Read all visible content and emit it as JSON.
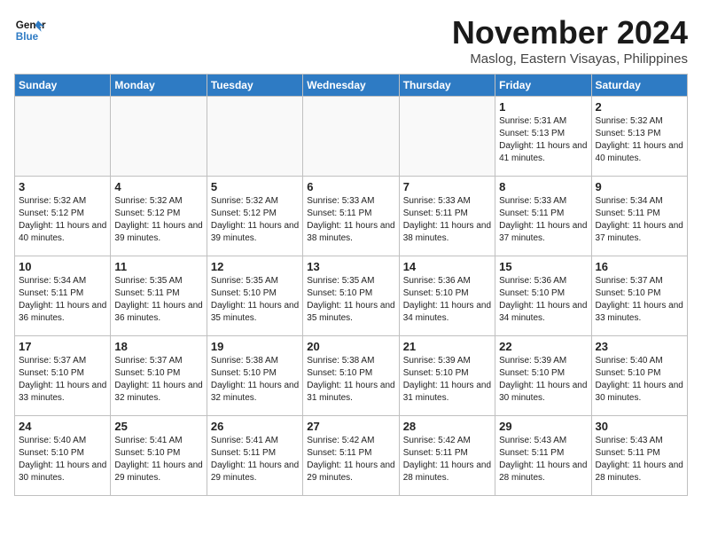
{
  "header": {
    "logo_line1": "General",
    "logo_line2": "Blue",
    "month": "November 2024",
    "location": "Maslog, Eastern Visayas, Philippines"
  },
  "weekdays": [
    "Sunday",
    "Monday",
    "Tuesday",
    "Wednesday",
    "Thursday",
    "Friday",
    "Saturday"
  ],
  "weeks": [
    [
      {
        "day": "",
        "sunrise": "",
        "sunset": "",
        "daylight": "",
        "empty": true
      },
      {
        "day": "",
        "sunrise": "",
        "sunset": "",
        "daylight": "",
        "empty": true
      },
      {
        "day": "",
        "sunrise": "",
        "sunset": "",
        "daylight": "",
        "empty": true
      },
      {
        "day": "",
        "sunrise": "",
        "sunset": "",
        "daylight": "",
        "empty": true
      },
      {
        "day": "",
        "sunrise": "",
        "sunset": "",
        "daylight": "",
        "empty": true
      },
      {
        "day": "1",
        "sunrise": "Sunrise: 5:31 AM",
        "sunset": "Sunset: 5:13 PM",
        "daylight": "Daylight: 11 hours and 41 minutes.",
        "empty": false
      },
      {
        "day": "2",
        "sunrise": "Sunrise: 5:32 AM",
        "sunset": "Sunset: 5:13 PM",
        "daylight": "Daylight: 11 hours and 40 minutes.",
        "empty": false
      }
    ],
    [
      {
        "day": "3",
        "sunrise": "Sunrise: 5:32 AM",
        "sunset": "Sunset: 5:12 PM",
        "daylight": "Daylight: 11 hours and 40 minutes.",
        "empty": false
      },
      {
        "day": "4",
        "sunrise": "Sunrise: 5:32 AM",
        "sunset": "Sunset: 5:12 PM",
        "daylight": "Daylight: 11 hours and 39 minutes.",
        "empty": false
      },
      {
        "day": "5",
        "sunrise": "Sunrise: 5:32 AM",
        "sunset": "Sunset: 5:12 PM",
        "daylight": "Daylight: 11 hours and 39 minutes.",
        "empty": false
      },
      {
        "day": "6",
        "sunrise": "Sunrise: 5:33 AM",
        "sunset": "Sunset: 5:11 PM",
        "daylight": "Daylight: 11 hours and 38 minutes.",
        "empty": false
      },
      {
        "day": "7",
        "sunrise": "Sunrise: 5:33 AM",
        "sunset": "Sunset: 5:11 PM",
        "daylight": "Daylight: 11 hours and 38 minutes.",
        "empty": false
      },
      {
        "day": "8",
        "sunrise": "Sunrise: 5:33 AM",
        "sunset": "Sunset: 5:11 PM",
        "daylight": "Daylight: 11 hours and 37 minutes.",
        "empty": false
      },
      {
        "day": "9",
        "sunrise": "Sunrise: 5:34 AM",
        "sunset": "Sunset: 5:11 PM",
        "daylight": "Daylight: 11 hours and 37 minutes.",
        "empty": false
      }
    ],
    [
      {
        "day": "10",
        "sunrise": "Sunrise: 5:34 AM",
        "sunset": "Sunset: 5:11 PM",
        "daylight": "Daylight: 11 hours and 36 minutes.",
        "empty": false
      },
      {
        "day": "11",
        "sunrise": "Sunrise: 5:35 AM",
        "sunset": "Sunset: 5:11 PM",
        "daylight": "Daylight: 11 hours and 36 minutes.",
        "empty": false
      },
      {
        "day": "12",
        "sunrise": "Sunrise: 5:35 AM",
        "sunset": "Sunset: 5:10 PM",
        "daylight": "Daylight: 11 hours and 35 minutes.",
        "empty": false
      },
      {
        "day": "13",
        "sunrise": "Sunrise: 5:35 AM",
        "sunset": "Sunset: 5:10 PM",
        "daylight": "Daylight: 11 hours and 35 minutes.",
        "empty": false
      },
      {
        "day": "14",
        "sunrise": "Sunrise: 5:36 AM",
        "sunset": "Sunset: 5:10 PM",
        "daylight": "Daylight: 11 hours and 34 minutes.",
        "empty": false
      },
      {
        "day": "15",
        "sunrise": "Sunrise: 5:36 AM",
        "sunset": "Sunset: 5:10 PM",
        "daylight": "Daylight: 11 hours and 34 minutes.",
        "empty": false
      },
      {
        "day": "16",
        "sunrise": "Sunrise: 5:37 AM",
        "sunset": "Sunset: 5:10 PM",
        "daylight": "Daylight: 11 hours and 33 minutes.",
        "empty": false
      }
    ],
    [
      {
        "day": "17",
        "sunrise": "Sunrise: 5:37 AM",
        "sunset": "Sunset: 5:10 PM",
        "daylight": "Daylight: 11 hours and 33 minutes.",
        "empty": false
      },
      {
        "day": "18",
        "sunrise": "Sunrise: 5:37 AM",
        "sunset": "Sunset: 5:10 PM",
        "daylight": "Daylight: 11 hours and 32 minutes.",
        "empty": false
      },
      {
        "day": "19",
        "sunrise": "Sunrise: 5:38 AM",
        "sunset": "Sunset: 5:10 PM",
        "daylight": "Daylight: 11 hours and 32 minutes.",
        "empty": false
      },
      {
        "day": "20",
        "sunrise": "Sunrise: 5:38 AM",
        "sunset": "Sunset: 5:10 PM",
        "daylight": "Daylight: 11 hours and 31 minutes.",
        "empty": false
      },
      {
        "day": "21",
        "sunrise": "Sunrise: 5:39 AM",
        "sunset": "Sunset: 5:10 PM",
        "daylight": "Daylight: 11 hours and 31 minutes.",
        "empty": false
      },
      {
        "day": "22",
        "sunrise": "Sunrise: 5:39 AM",
        "sunset": "Sunset: 5:10 PM",
        "daylight": "Daylight: 11 hours and 30 minutes.",
        "empty": false
      },
      {
        "day": "23",
        "sunrise": "Sunrise: 5:40 AM",
        "sunset": "Sunset: 5:10 PM",
        "daylight": "Daylight: 11 hours and 30 minutes.",
        "empty": false
      }
    ],
    [
      {
        "day": "24",
        "sunrise": "Sunrise: 5:40 AM",
        "sunset": "Sunset: 5:10 PM",
        "daylight": "Daylight: 11 hours and 30 minutes.",
        "empty": false
      },
      {
        "day": "25",
        "sunrise": "Sunrise: 5:41 AM",
        "sunset": "Sunset: 5:10 PM",
        "daylight": "Daylight: 11 hours and 29 minutes.",
        "empty": false
      },
      {
        "day": "26",
        "sunrise": "Sunrise: 5:41 AM",
        "sunset": "Sunset: 5:11 PM",
        "daylight": "Daylight: 11 hours and 29 minutes.",
        "empty": false
      },
      {
        "day": "27",
        "sunrise": "Sunrise: 5:42 AM",
        "sunset": "Sunset: 5:11 PM",
        "daylight": "Daylight: 11 hours and 29 minutes.",
        "empty": false
      },
      {
        "day": "28",
        "sunrise": "Sunrise: 5:42 AM",
        "sunset": "Sunset: 5:11 PM",
        "daylight": "Daylight: 11 hours and 28 minutes.",
        "empty": false
      },
      {
        "day": "29",
        "sunrise": "Sunrise: 5:43 AM",
        "sunset": "Sunset: 5:11 PM",
        "daylight": "Daylight: 11 hours and 28 minutes.",
        "empty": false
      },
      {
        "day": "30",
        "sunrise": "Sunrise: 5:43 AM",
        "sunset": "Sunset: 5:11 PM",
        "daylight": "Daylight: 11 hours and 28 minutes.",
        "empty": false
      }
    ]
  ]
}
